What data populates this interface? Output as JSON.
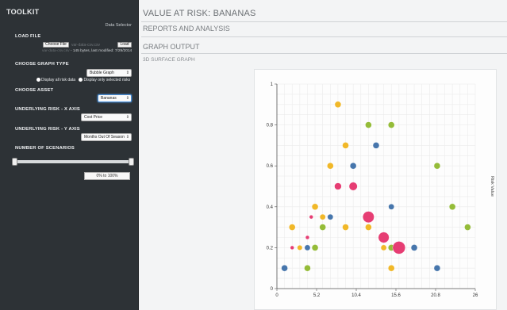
{
  "sidebar": {
    "title": "TOOLKIT",
    "subtitle": "Data Selector",
    "load_file": {
      "label": "LOAD FILE",
      "choose_label": "Choose File",
      "file_name": "var-data-csv.csv",
      "load_label": "Load",
      "info_prefix": "var-data-csv.csv",
      "info_text": " - 145 bytes, last modified: 7/29/2014"
    },
    "graph_type": {
      "label": "CHOOSE GRAPH TYPE",
      "selected": "Bubble Graph",
      "radio_all": "Display all risk data",
      "radio_selected": "Display only selected risks"
    },
    "asset": {
      "label": "CHOOSE ASSET",
      "selected": "Bananas"
    },
    "x_axis": {
      "label": "UNDERLYING RISK - X AXIS",
      "selected": "Cost Price"
    },
    "y_axis": {
      "label": "UNDERLYING RISK - Y AXIS",
      "selected": "Months Out Of Season"
    },
    "scenarios": {
      "label": "NUMBER OF SCENARIOS",
      "range_text": "0% to 100%",
      "range_low": 0,
      "range_high": 100
    }
  },
  "main": {
    "title": "VALUE AT RISK: BANANAS",
    "subtitle": "REPORTS AND ANALYSIS",
    "section": "GRAPH OUTPUT",
    "graph_subtitle": "3D SURFACE GRAPH"
  },
  "colors": {
    "yellow": "#f0b41e",
    "green": "#8fb82e",
    "blue": "#3d6fa8",
    "pink": "#e5336b"
  },
  "chart_data": {
    "type": "scatter",
    "variant": "bubble",
    "title": "",
    "xlabel": "",
    "ylabel": "Risk Value",
    "xlim": [
      0,
      26
    ],
    "ylim": [
      0,
      1
    ],
    "x_ticks": [
      "0",
      "5.2",
      "10.4",
      "15.6",
      "20.8",
      "26"
    ],
    "y_ticks": [
      "0",
      "0.2",
      "0.4",
      "0.6",
      "0.8",
      "1"
    ],
    "grid": true,
    "points": [
      {
        "x": 8,
        "y": 0.9,
        "size": 1,
        "color": "yellow"
      },
      {
        "x": 12,
        "y": 0.8,
        "size": 1,
        "color": "green"
      },
      {
        "x": 15,
        "y": 0.8,
        "size": 1,
        "color": "green"
      },
      {
        "x": 9,
        "y": 0.7,
        "size": 1,
        "color": "yellow"
      },
      {
        "x": 13,
        "y": 0.7,
        "size": 1,
        "color": "blue"
      },
      {
        "x": 7,
        "y": 0.6,
        "size": 1,
        "color": "yellow"
      },
      {
        "x": 10,
        "y": 0.6,
        "size": 1,
        "color": "blue"
      },
      {
        "x": 21,
        "y": 0.6,
        "size": 1,
        "color": "green"
      },
      {
        "x": 8,
        "y": 0.5,
        "size": 1.1,
        "color": "pink"
      },
      {
        "x": 10,
        "y": 0.5,
        "size": 1.3,
        "color": "pink"
      },
      {
        "x": 5,
        "y": 0.4,
        "size": 1,
        "color": "yellow"
      },
      {
        "x": 15,
        "y": 0.4,
        "size": 0.9,
        "color": "blue"
      },
      {
        "x": 23,
        "y": 0.4,
        "size": 1,
        "color": "green"
      },
      {
        "x": 4.5,
        "y": 0.35,
        "size": 0.6,
        "color": "pink"
      },
      {
        "x": 6,
        "y": 0.35,
        "size": 0.9,
        "color": "yellow"
      },
      {
        "x": 7,
        "y": 0.35,
        "size": 0.9,
        "color": "blue"
      },
      {
        "x": 12,
        "y": 0.35,
        "size": 1.8,
        "color": "pink"
      },
      {
        "x": 2,
        "y": 0.3,
        "size": 1,
        "color": "yellow"
      },
      {
        "x": 6,
        "y": 0.3,
        "size": 1,
        "color": "green"
      },
      {
        "x": 9,
        "y": 0.3,
        "size": 1,
        "color": "yellow"
      },
      {
        "x": 12,
        "y": 0.3,
        "size": 1,
        "color": "yellow"
      },
      {
        "x": 25,
        "y": 0.3,
        "size": 1,
        "color": "green"
      },
      {
        "x": 4,
        "y": 0.25,
        "size": 0.6,
        "color": "pink"
      },
      {
        "x": 14,
        "y": 0.25,
        "size": 1.7,
        "color": "pink"
      },
      {
        "x": 2,
        "y": 0.2,
        "size": 0.6,
        "color": "pink"
      },
      {
        "x": 3,
        "y": 0.2,
        "size": 0.8,
        "color": "yellow"
      },
      {
        "x": 4,
        "y": 0.2,
        "size": 0.9,
        "color": "blue"
      },
      {
        "x": 5,
        "y": 0.2,
        "size": 1,
        "color": "green"
      },
      {
        "x": 14,
        "y": 0.2,
        "size": 0.9,
        "color": "yellow"
      },
      {
        "x": 15,
        "y": 0.2,
        "size": 1,
        "color": "green"
      },
      {
        "x": 16,
        "y": 0.2,
        "size": 2,
        "color": "pink"
      },
      {
        "x": 18,
        "y": 0.2,
        "size": 1,
        "color": "blue"
      },
      {
        "x": 1,
        "y": 0.1,
        "size": 1,
        "color": "blue"
      },
      {
        "x": 4,
        "y": 0.1,
        "size": 1,
        "color": "green"
      },
      {
        "x": 15,
        "y": 0.1,
        "size": 1,
        "color": "yellow"
      },
      {
        "x": 21,
        "y": 0.1,
        "size": 1,
        "color": "blue"
      }
    ]
  }
}
